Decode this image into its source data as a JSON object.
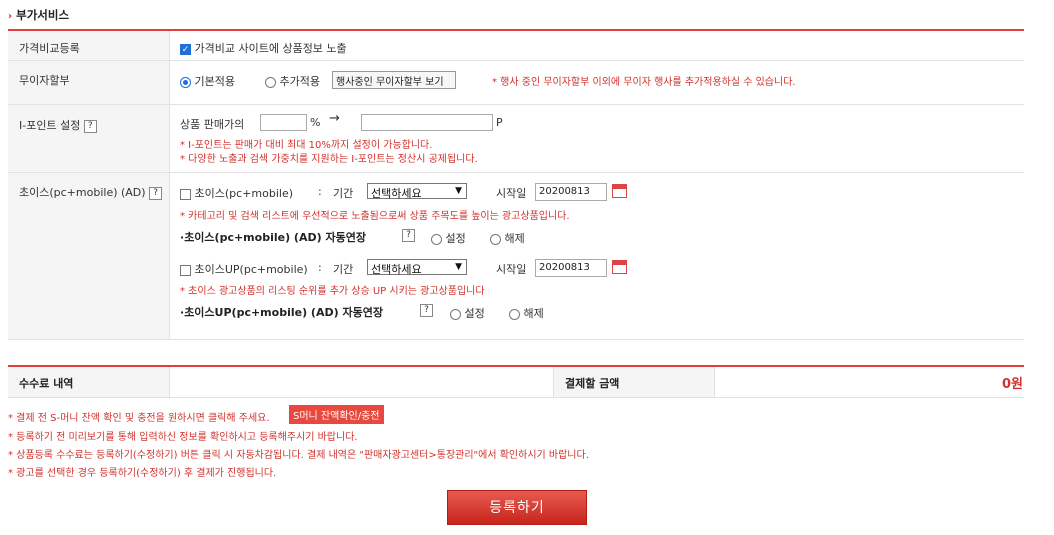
{
  "section_title": "부가서비스",
  "price_compare": {
    "label": "가격비교등록",
    "checkbox_label": "가격비교 사이트에 상품정보 노출"
  },
  "interest_free": {
    "label": "무이자할부",
    "option_default": "기본적용",
    "option_additional": "추가적용",
    "view_button": "행사중인 무이자할부 보기",
    "note": "* 행사 중인 무이자할부 이외에 무이자 행사를 추가적용하실 수 있습니다."
  },
  "ipoint": {
    "label": "I-포인트 설정",
    "help": "?",
    "prefix": "상품 판매가의",
    "percent": "%",
    "arrow": "→",
    "unit": "P",
    "note1": "* I-포인트는 판매가 대비 최대 10%까지 설정이 가능합니다.",
    "note2": "* 다양한 노출과 검색 가중치를 지원하는 I-포인트는 정산시 공제됩니다."
  },
  "choice": {
    "label": "초이스(pc+mobile) (AD)",
    "help": "?",
    "item1": {
      "checkbox_label": "초이스(pc+mobile)",
      "colon": ":",
      "period_label": "기간",
      "select_value": "선택하세요",
      "start_label": "시작일",
      "start_date": "20200813",
      "note": "* 카테고리 및 검색 리스트에 우선적으로 노출됨으로써 상품 주목도를 높이는 광고상품입니다.",
      "auto_renew_label": "초이스(pc+mobile) (AD) 자동연장",
      "opt_on": "설정",
      "opt_off": "해제"
    },
    "item2": {
      "checkbox_label": "초이스UP(pc+mobile)",
      "colon": ":",
      "period_label": "기간",
      "select_value": "선택하세요",
      "start_label": "시작일",
      "start_date": "20200813",
      "note": "* 초이스 광고상품의 리스팅 순위를 추가 상승 UP 시키는 광고상품입니다",
      "auto_renew_label": "초이스UP(pc+mobile) (AD) 자동연장",
      "opt_on": "설정",
      "opt_off": "해제"
    }
  },
  "fee": {
    "label": "수수료 내역",
    "pay_label": "결제할 금액",
    "amount": "0원"
  },
  "notices": {
    "n1": "* 결제 전 S-머니 잔액 확인 및 충전을 원하시면 클릭해 주세요.",
    "n1_button": "S머니 잔액확인/충전",
    "n2": "* 등록하기 전 미리보기를 통해 입력하신 정보를 확인하시고 등록해주시기 바랍니다.",
    "n3": "* 상품등록 수수료는 등록하기(수정하기) 버튼 클릭 시 자동차감됩니다. 결제 내역은 \"판매자광고센터>통장관리\"에서 확인하시기 바랍니다.",
    "n4": "* 광고를 선택한 경우 등록하기(수정하기) 후 결제가 진행됩니다."
  },
  "submit_button": "등록하기",
  "colors": {
    "accent": "#e4403b",
    "notice": "#d2322d",
    "link_blue": "#1f6fd6"
  }
}
